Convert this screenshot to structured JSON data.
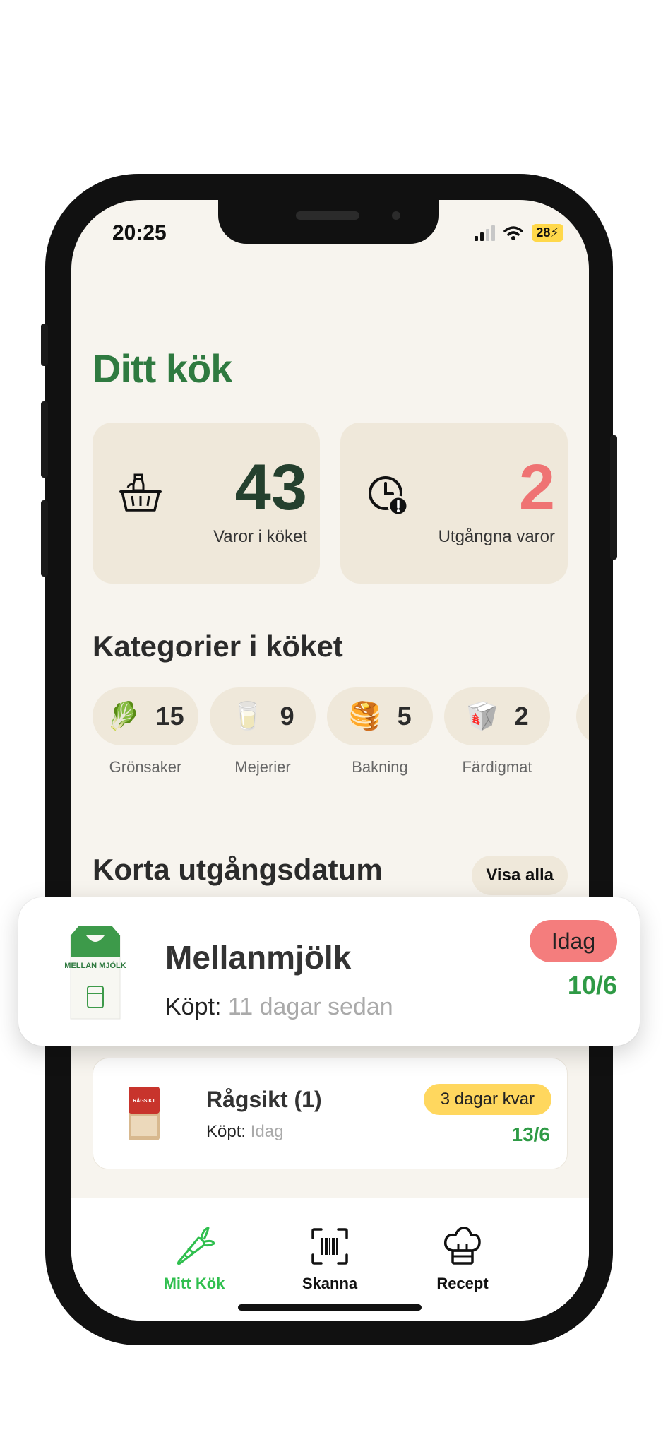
{
  "status_bar": {
    "time": "20:25",
    "battery": "28"
  },
  "header": {
    "title": "Ditt kök"
  },
  "stats": {
    "items": {
      "value": "43",
      "label": "Varor i köket",
      "icon": "basket-icon",
      "color": "#24402e"
    },
    "expired": {
      "value": "2",
      "label": "Utgångna varor",
      "icon": "clock-alert-icon",
      "color": "#ef7373"
    }
  },
  "categories": {
    "title": "Kategorier i köket",
    "items": [
      {
        "emoji": "🥬",
        "count": "15",
        "name": "Grönsaker"
      },
      {
        "emoji": "🥛",
        "count": "9",
        "name": "Mejerier"
      },
      {
        "emoji": "🥞",
        "count": "5",
        "name": "Bakning"
      },
      {
        "emoji": "🥡",
        "count": "2",
        "name": "Färdigmat"
      }
    ]
  },
  "expiring": {
    "title": "Korta utgångsdatum",
    "see_all": "Visa alla",
    "featured": {
      "name": "Mellanmjölk",
      "bought_label": "Köpt:",
      "bought_value": "11 dagar sedan",
      "badge": "Idag",
      "date": "10/6",
      "package_text": "MELLAN MJÖLK"
    },
    "items": [
      {
        "name": "Rågsikt (1)",
        "bought_label": "Köpt:",
        "bought_value": "Idag",
        "badge": "3 dagar kvar",
        "date": "13/6",
        "package_text": "RÅGSIKT"
      }
    ]
  },
  "nav": {
    "items": [
      {
        "label": "Mitt Kök",
        "icon": "carrot-icon",
        "active": true
      },
      {
        "label": "Skanna",
        "icon": "barcode-scan-icon",
        "active": false
      },
      {
        "label": "Recept",
        "icon": "chef-hat-icon",
        "active": false
      }
    ]
  },
  "colors": {
    "brand_green": "#2f7a40",
    "accent_green": "#2fbf4e",
    "expired_red": "#ef7373",
    "warning_yellow": "#ffd75e",
    "card_beige": "#efe8da"
  }
}
